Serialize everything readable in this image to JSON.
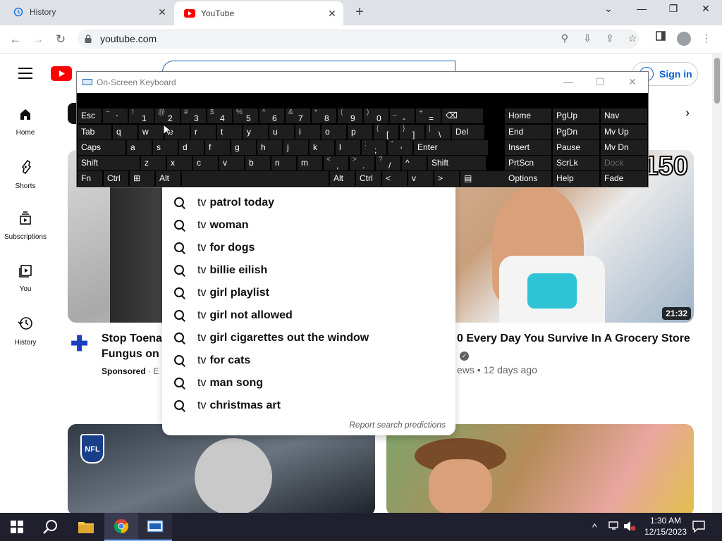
{
  "browser": {
    "tabs": [
      {
        "title": "History"
      },
      {
        "title": "YouTube"
      }
    ],
    "url": "youtube.com"
  },
  "youtube": {
    "sidebar": [
      {
        "label": "Home",
        "icon": "home-icon"
      },
      {
        "label": "Shorts",
        "icon": "shorts-icon"
      },
      {
        "label": "Subscriptions",
        "icon": "subscriptions-icon"
      },
      {
        "label": "You",
        "icon": "you-icon"
      },
      {
        "label": "History",
        "icon": "history-icon"
      }
    ],
    "sign_in": "Sign in",
    "suggestions": [
      {
        "prefix": "tv",
        "rest": "patrol today"
      },
      {
        "prefix": "tv",
        "rest": "woman"
      },
      {
        "prefix": "tv",
        "rest": "for dogs"
      },
      {
        "prefix": "tv",
        "rest": "billie eilish"
      },
      {
        "prefix": "tv",
        "rest": "girl playlist"
      },
      {
        "prefix": "tv",
        "rest": "girl not allowed"
      },
      {
        "prefix": "tv",
        "rest": "girl cigarettes out the window"
      },
      {
        "prefix": "tv",
        "rest": "for cats"
      },
      {
        "prefix": "tv",
        "rest": "man song"
      },
      {
        "prefix": "tv",
        "rest": "christmas art"
      }
    ],
    "report": "Report search predictions",
    "videos": [
      {
        "title_l1": "Stop Toenai",
        "title_l2": "Fungus on C",
        "meta": "Sponsored",
        "meta2": "· E"
      },
      {
        "title_l1": "0 Every Day You Survive In A Grocery Store",
        "duration": "21:32",
        "thumb_text": "150",
        "meta": "ews • 12 days ago"
      },
      {
        "thumb_text": "NFL"
      }
    ]
  },
  "osk": {
    "title": "On-Screen Keyboard",
    "row1": [
      {
        "l": "Esc"
      },
      {
        "s": "~",
        "m": "`"
      },
      {
        "s": "!",
        "m": "1"
      },
      {
        "s": "@",
        "m": "2"
      },
      {
        "s": "#",
        "m": "3"
      },
      {
        "s": "$",
        "m": "4"
      },
      {
        "s": "%",
        "m": "5"
      },
      {
        "s": "^",
        "m": "6"
      },
      {
        "s": "&",
        "m": "7"
      },
      {
        "s": "*",
        "m": "8"
      },
      {
        "s": "(",
        "m": "9"
      },
      {
        "s": ")",
        "m": "0"
      },
      {
        "s": "_",
        "m": "-"
      },
      {
        "s": "+",
        "m": "="
      },
      {
        "l": "⌫"
      }
    ],
    "row2": [
      {
        "l": "Tab"
      },
      {
        "l": "q"
      },
      {
        "l": "w"
      },
      {
        "l": "e"
      },
      {
        "l": "r"
      },
      {
        "l": "t"
      },
      {
        "l": "y"
      },
      {
        "l": "u"
      },
      {
        "l": "i"
      },
      {
        "l": "o"
      },
      {
        "l": "p"
      },
      {
        "s": "{",
        "m": "["
      },
      {
        "s": "}",
        "m": "]"
      },
      {
        "s": "|",
        "m": "\\"
      },
      {
        "l": "Del"
      }
    ],
    "row3": [
      {
        "l": "Caps"
      },
      {
        "l": "a"
      },
      {
        "l": "s"
      },
      {
        "l": "d"
      },
      {
        "l": "f"
      },
      {
        "l": "g"
      },
      {
        "l": "h"
      },
      {
        "l": "j"
      },
      {
        "l": "k"
      },
      {
        "l": "l"
      },
      {
        "s": ":",
        "m": ";"
      },
      {
        "s": "\"",
        "m": "'"
      },
      {
        "l": "Enter"
      }
    ],
    "row4": [
      {
        "l": "Shift"
      },
      {
        "l": "z"
      },
      {
        "l": "x"
      },
      {
        "l": "c"
      },
      {
        "l": "v"
      },
      {
        "l": "b"
      },
      {
        "l": "n"
      },
      {
        "l": "m"
      },
      {
        "s": "<",
        "m": ","
      },
      {
        "s": ">",
        "m": "."
      },
      {
        "s": "?",
        "m": "/"
      },
      {
        "l": "^"
      },
      {
        "l": "Shift"
      }
    ],
    "row5": [
      {
        "l": "Fn"
      },
      {
        "l": "Ctrl"
      },
      {
        "l": "⊞"
      },
      {
        "l": "Alt"
      },
      {
        "l": ""
      },
      {
        "l": "Alt"
      },
      {
        "l": "Ctrl"
      },
      {
        "l": "<"
      },
      {
        "l": "v"
      },
      {
        "l": ">"
      },
      {
        "l": "▤"
      }
    ],
    "nav": [
      [
        "Home",
        "PgUp",
        "Nav"
      ],
      [
        "End",
        "PgDn",
        "Mv Up"
      ],
      [
        "Insert",
        "Pause",
        "Mv Dn"
      ],
      [
        "PrtScn",
        "ScrLk",
        "Dock"
      ],
      [
        "Options",
        "Help",
        "Fade"
      ]
    ]
  },
  "taskbar": {
    "time": "1:30 AM",
    "date": "12/15/2023"
  }
}
